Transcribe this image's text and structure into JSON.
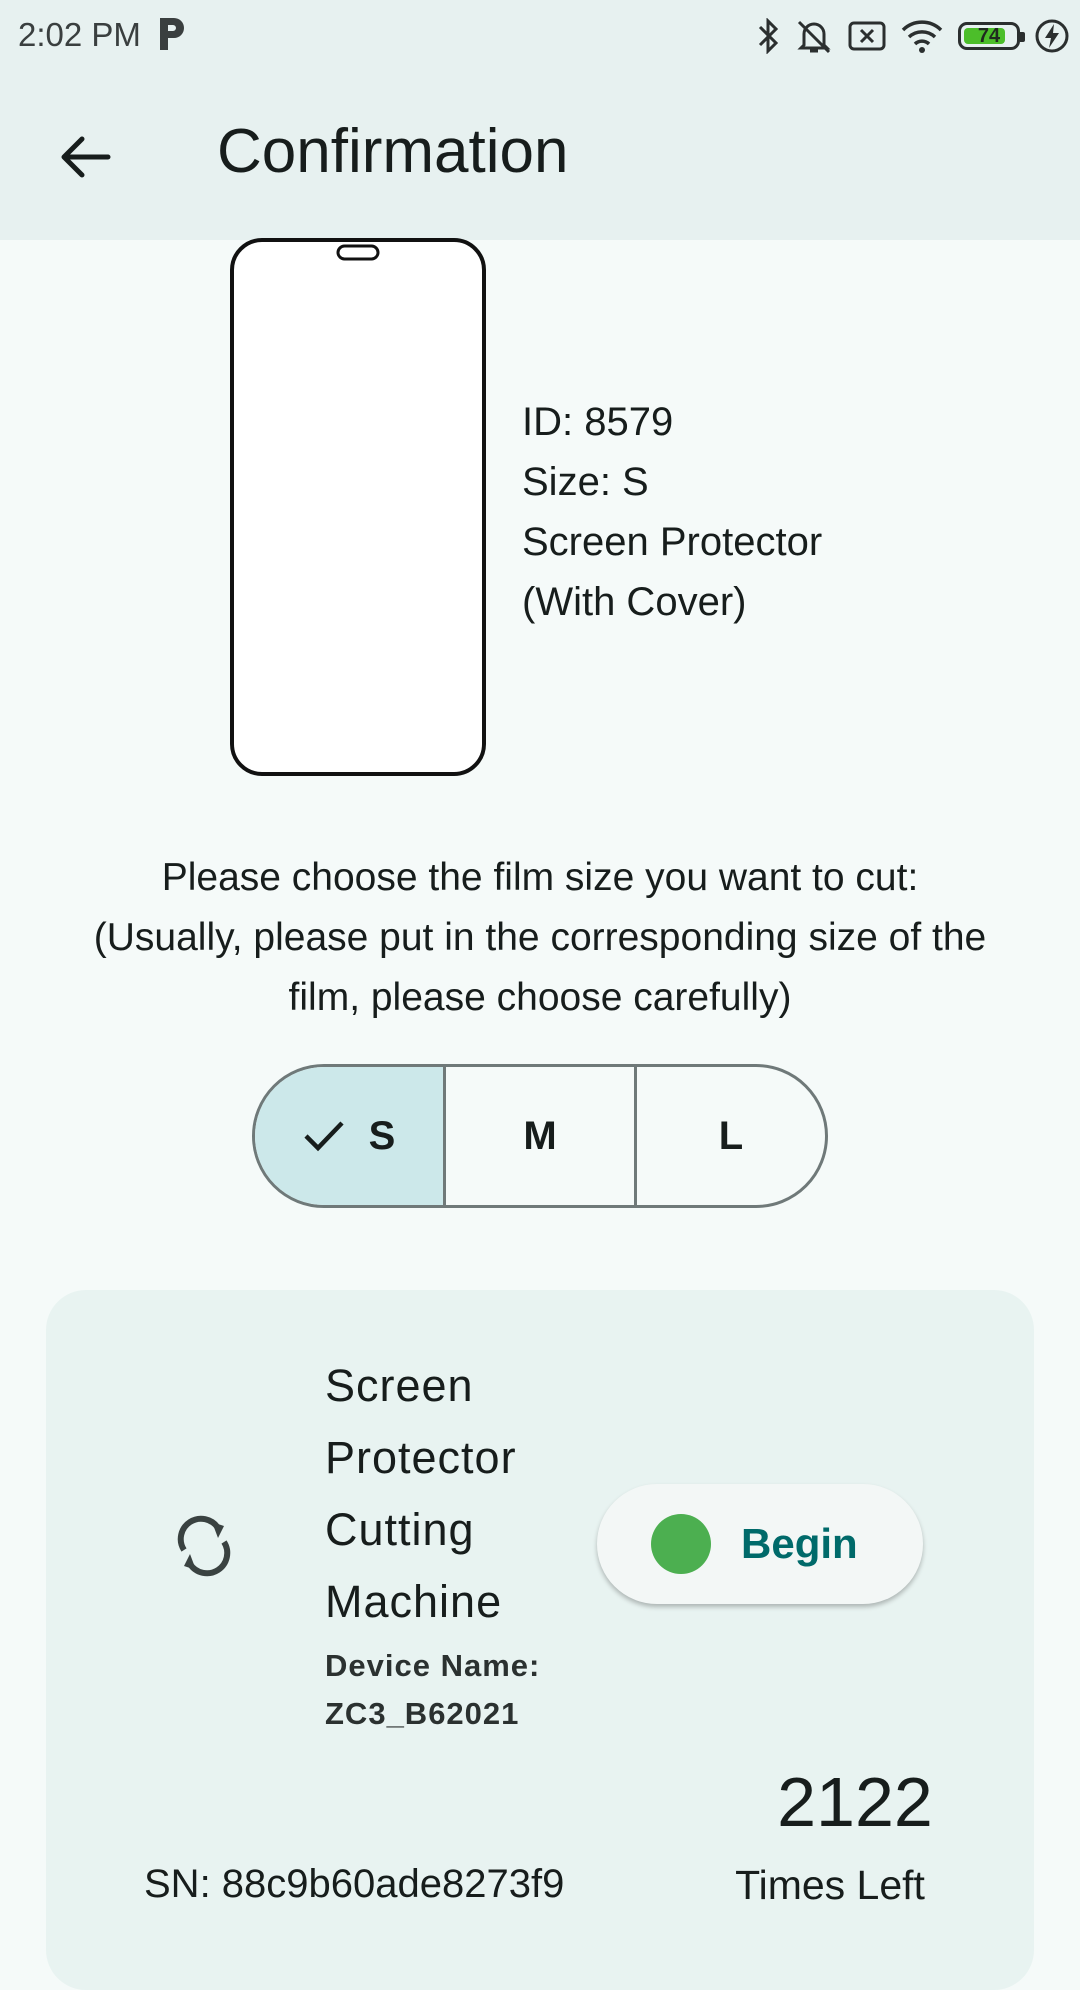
{
  "status_bar": {
    "time": "2:02 PM",
    "battery": "74",
    "icons": [
      "p-app-icon",
      "bluetooth-icon",
      "mute-icon",
      "sim-off-icon",
      "wifi-icon",
      "battery-icon",
      "charging-icon"
    ]
  },
  "app_bar": {
    "title": "Confirmation",
    "back_icon": "arrow-left-icon"
  },
  "product": {
    "id_line": "ID: 8579",
    "size_line": "Size: S",
    "type_line1": "Screen Protector",
    "type_line2": "(With Cover)"
  },
  "prompt": {
    "line1": "Please choose the film size you want to cut:",
    "line2": "(Usually, please put in the corresponding size of the",
    "line3": "film, please choose carefully)"
  },
  "size_selector": {
    "options": [
      "S",
      "M",
      "L"
    ],
    "selected": "S",
    "selected_color": "#cce8ea"
  },
  "device_card": {
    "name_lines": [
      "Screen",
      "Protector",
      "Cutting",
      "Machine"
    ],
    "device_name_label": "Device Name:",
    "device_name_value": "ZC3_B62021",
    "begin_label": "Begin",
    "status_color": "#4caf50",
    "times_left_value": "2122",
    "times_left_label": "Times Left",
    "sn": "SN: 88c9b60ade8273f9"
  },
  "colors": {
    "accent": "#006a6a",
    "bar_bg": "#e7f1f0",
    "page_bg": "#f5faf9"
  }
}
